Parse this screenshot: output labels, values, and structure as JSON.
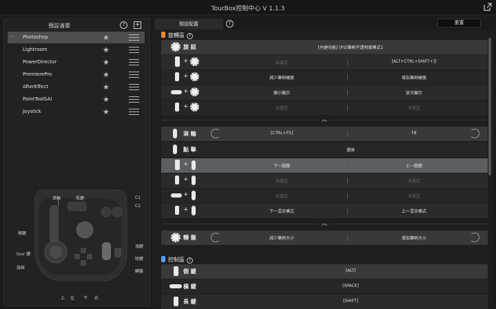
{
  "app": {
    "title": "TourBox控制中心 V 1.1.3"
  },
  "left": {
    "title": "預設清單",
    "presets": [
      {
        "name": "Photoshop",
        "selected": true
      },
      {
        "name": "Lightroom",
        "selected": false
      },
      {
        "name": "PowerDirector",
        "selected": false
      },
      {
        "name": "PremierePro",
        "selected": false
      },
      {
        "name": "AfterEffect",
        "selected": false
      },
      {
        "name": "PaintToolSAI",
        "selected": false
      },
      {
        "name": "Joystick",
        "selected": false
      }
    ],
    "device_labels": {
      "scroll": "滾輪",
      "tall": "長鍵",
      "c1": "C1",
      "c2": "C2",
      "side": "側鍵",
      "tour": "tour 鍵",
      "knob": "旋鈕",
      "top": "頂鍵",
      "short": "短鍵",
      "dial": "轉盤",
      "up": "上",
      "left": "左",
      "down": "下",
      "right": "右"
    }
  },
  "right": {
    "tab": "預設配置",
    "reset": "重置",
    "knob_section": "旋轉區",
    "knob_row": {
      "label": "旋 鈕",
      "value": "[內建功能] [PS]筆刷不透明度模式1"
    },
    "knob_combos": [
      {
        "left": "未設定",
        "right": "[ALT+CTRL+SHIFT+]]"
      },
      {
        "left": "減少筆刷硬度",
        "right": "增加筆刷硬度"
      },
      {
        "left": "縮小顯示",
        "right": "放大顯示"
      },
      {
        "left": "未設定",
        "right": "未設定"
      }
    ],
    "scroll_row": {
      "label": "滾 輪",
      "left": "[CTRL+F5]",
      "right": "F8"
    },
    "click_row": {
      "label": "點 擊",
      "value": "還原"
    },
    "scroll_combos": [
      {
        "left": "下一圖層",
        "right": "上一圖層"
      },
      {
        "left": "未設定",
        "right": "未設定"
      },
      {
        "left": "未設定",
        "right": "未設定"
      },
      {
        "left": "下一混合模式",
        "right": "上一混合模式"
      }
    ],
    "dial_row": {
      "label": "轉 盤",
      "left": "減少筆刷大小",
      "right": "增加筆刷大小"
    },
    "control_section": "控制區",
    "control_rows": [
      {
        "label": "側 鍵",
        "value": "[ALT]"
      },
      {
        "label": "橫 鍵",
        "value": "[SPACE]"
      },
      {
        "label": "長 鍵",
        "value": "[SHIFT]"
      }
    ],
    "colors": {
      "knob_badge": "#f08a24",
      "control_badge": "#4aa3ff"
    }
  }
}
